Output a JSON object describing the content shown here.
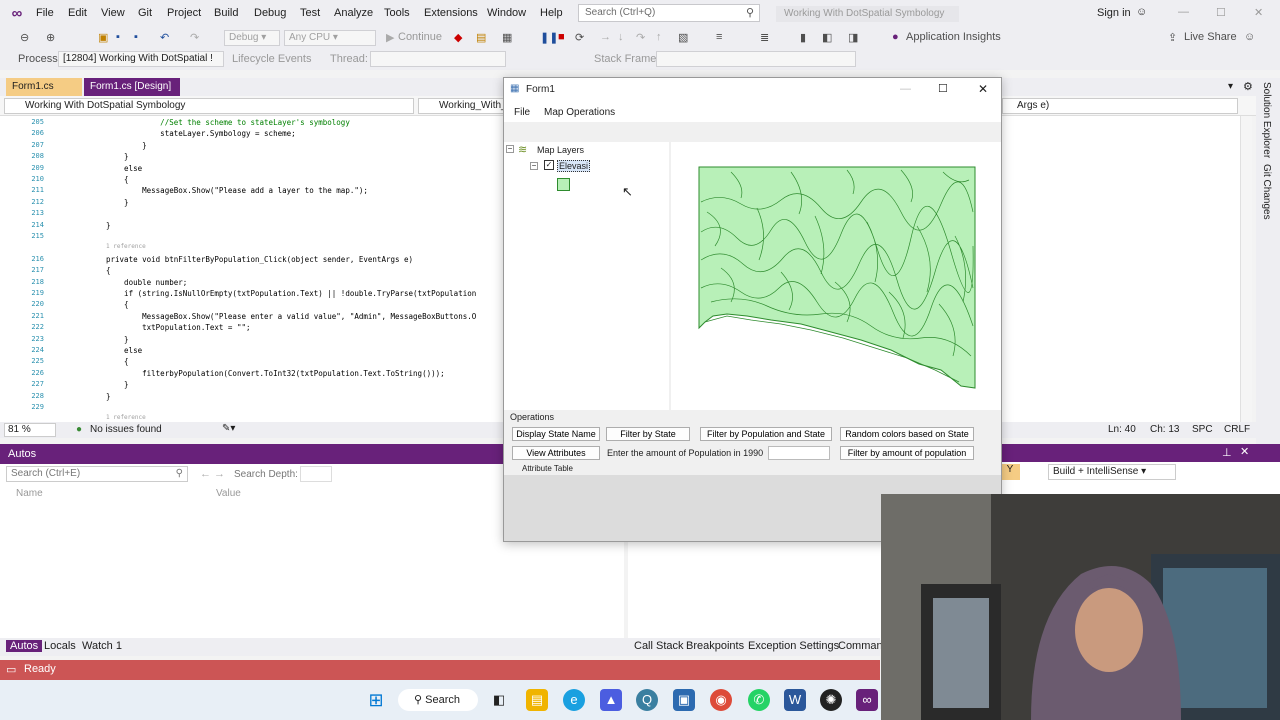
{
  "vs": {
    "menu": [
      "File",
      "Edit",
      "View",
      "Git",
      "Project",
      "Build",
      "Debug",
      "Test",
      "Analyze",
      "Tools",
      "Extensions",
      "Window",
      "Help"
    ],
    "search_placeholder": "Search (Ctrl+Q)",
    "solution_title": "Working With DotSpatial Symbology",
    "sign_in": "Sign in",
    "toolbar": {
      "config": "Debug",
      "platform": "Any CPU",
      "continue": "Continue",
      "app_insights": "Application Insights",
      "live_share": "Live Share"
    },
    "debugbar": {
      "process_label": "Process:",
      "process_value": "[12804] Working With DotSpatial !",
      "lifecycle": "Lifecycle Events",
      "thread": "Thread:",
      "stack_frame": "Stack Frame:"
    },
    "tabs": [
      "Form1.cs",
      "Form1.cs [Design]"
    ],
    "nav": {
      "project": "Working With DotSpatial Symbology",
      "class": "Working_With_",
      "member": "Args e)"
    },
    "code": [
      {
        "n": "205",
        "t": "            //Set the scheme to stateLayer's symbology",
        "k": "c"
      },
      {
        "n": "206",
        "t": "            stateLayer.Symbology = scheme;",
        "k": ""
      },
      {
        "n": "207",
        "t": "        }",
        "k": ""
      },
      {
        "n": "208",
        "t": "    }",
        "k": ""
      },
      {
        "n": "209",
        "t": "    else",
        "k": ""
      },
      {
        "n": "210",
        "t": "    {",
        "k": ""
      },
      {
        "n": "211",
        "t": "        MessageBox.Show(\"Please add a layer to the map.\");",
        "k": ""
      },
      {
        "n": "212",
        "t": "    }",
        "k": ""
      },
      {
        "n": "213",
        "t": "",
        "k": ""
      },
      {
        "n": "214",
        "t": "}",
        "k": ""
      },
      {
        "n": "215",
        "t": "",
        "k": ""
      },
      {
        "n": "",
        "t": "1 reference",
        "k": "r"
      },
      {
        "n": "216",
        "t": "private void btnFilterByPopulation_Click(object sender, EventArgs e)",
        "k": ""
      },
      {
        "n": "217",
        "t": "{",
        "k": ""
      },
      {
        "n": "218",
        "t": "    double number;",
        "k": ""
      },
      {
        "n": "219",
        "t": "    if (string.IsNullOrEmpty(txtPopulation.Text) || !double.TryParse(txtPopulation",
        "k": ""
      },
      {
        "n": "220",
        "t": "    {",
        "k": ""
      },
      {
        "n": "221",
        "t": "        MessageBox.Show(\"Please enter a valid value\", \"Admin\", MessageBoxButtons.O",
        "k": ""
      },
      {
        "n": "222",
        "t": "        txtPopulation.Text = \"\";",
        "k": ""
      },
      {
        "n": "223",
        "t": "    }",
        "k": ""
      },
      {
        "n": "224",
        "t": "    else",
        "k": ""
      },
      {
        "n": "225",
        "t": "    {",
        "k": ""
      },
      {
        "n": "226",
        "t": "        filterbyPopulation(Convert.ToInt32(txtPopulation.Text.ToString()));",
        "k": ""
      },
      {
        "n": "227",
        "t": "    }",
        "k": ""
      },
      {
        "n": "228",
        "t": "}",
        "k": ""
      },
      {
        "n": "229",
        "t": "",
        "k": ""
      },
      {
        "n": "",
        "t": "1 reference",
        "k": "r"
      }
    ],
    "status": {
      "zoom": "81 %",
      "issues": "No issues found",
      "ln": "Ln: 40",
      "ch": "Ch: 13",
      "spc": "SPC",
      "crlf": "CRLF"
    },
    "side_tabs": [
      "Solution Explorer",
      "Git Changes"
    ],
    "autos": {
      "title": "Autos",
      "search": "Search (Ctrl+E)",
      "depth": "Search Depth:",
      "col_name": "Name",
      "col_value": "Value"
    },
    "bottom_tabs_left": [
      "Autos",
      "Locals",
      "Watch 1"
    ],
    "bottom_tabs_right": [
      "Call Stack",
      "Breakpoints",
      "Exception Settings",
      "Command"
    ],
    "build_filter": "Build + IntelliSense",
    "ready": "Ready"
  },
  "form1": {
    "title": "Form1",
    "menu": [
      "File",
      "Map Operations"
    ],
    "tree_root": "Map Layers",
    "layer": "Elevasi",
    "layer_checked": true,
    "ops_label": "Operations",
    "buttons_row1": [
      "Display State Name",
      "Filter by State",
      "Filter by Population and State",
      "Random colors based on State"
    ],
    "view_attributes": "View Attributes",
    "population_prompt": "Enter the amount of Population in 1990",
    "population_value": "",
    "filter_amount": "Filter by amount of population",
    "attribute_table": "Attribute Table"
  },
  "taskbar": {
    "search": "Search"
  },
  "colors": {
    "vs_purple": "#68217a",
    "tab_active": "#f5cc84",
    "map_fill": "#b8f0b8",
    "map_stroke": "#2e8b2e",
    "ready_bar": "#cc5555"
  }
}
